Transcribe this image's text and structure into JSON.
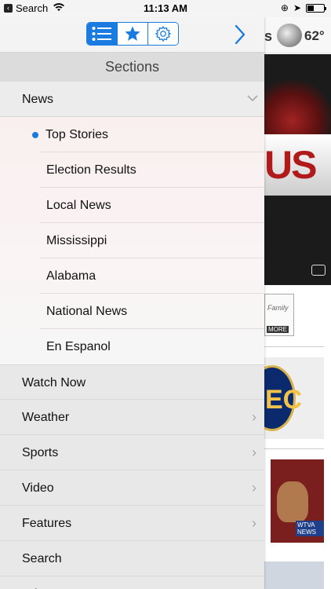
{
  "status_bar": {
    "back_app": "Search",
    "time": "11:13 AM"
  },
  "toolbar": {
    "tabs": [
      "list",
      "favorites",
      "settings"
    ],
    "active_tab": "list",
    "accent_color": "#1a7ce0"
  },
  "menu": {
    "title": "Sections",
    "expanded": {
      "label": "News",
      "items": [
        {
          "label": "Top Stories",
          "selected": true
        },
        {
          "label": "Election Results"
        },
        {
          "label": "Local News"
        },
        {
          "label": "Mississippi"
        },
        {
          "label": "Alabama"
        },
        {
          "label": "National News"
        },
        {
          "label": "En Espanol"
        }
      ]
    },
    "items": [
      {
        "label": "Watch Now",
        "chevron": false
      },
      {
        "label": "Weather",
        "chevron": true
      },
      {
        "label": "Sports",
        "chevron": true
      },
      {
        "label": "Video",
        "chevron": true
      },
      {
        "label": "Features",
        "chevron": true
      },
      {
        "label": "Search",
        "chevron": false
      },
      {
        "label": "Privacy",
        "chevron": false
      }
    ]
  },
  "background_app": {
    "header_fragment": "s",
    "temperature": "62°",
    "hero_text": "US",
    "promo_text": "Family",
    "promo_more": "MORE",
    "sec_logo": "EC",
    "news_tag": "WTVA NEWS"
  }
}
